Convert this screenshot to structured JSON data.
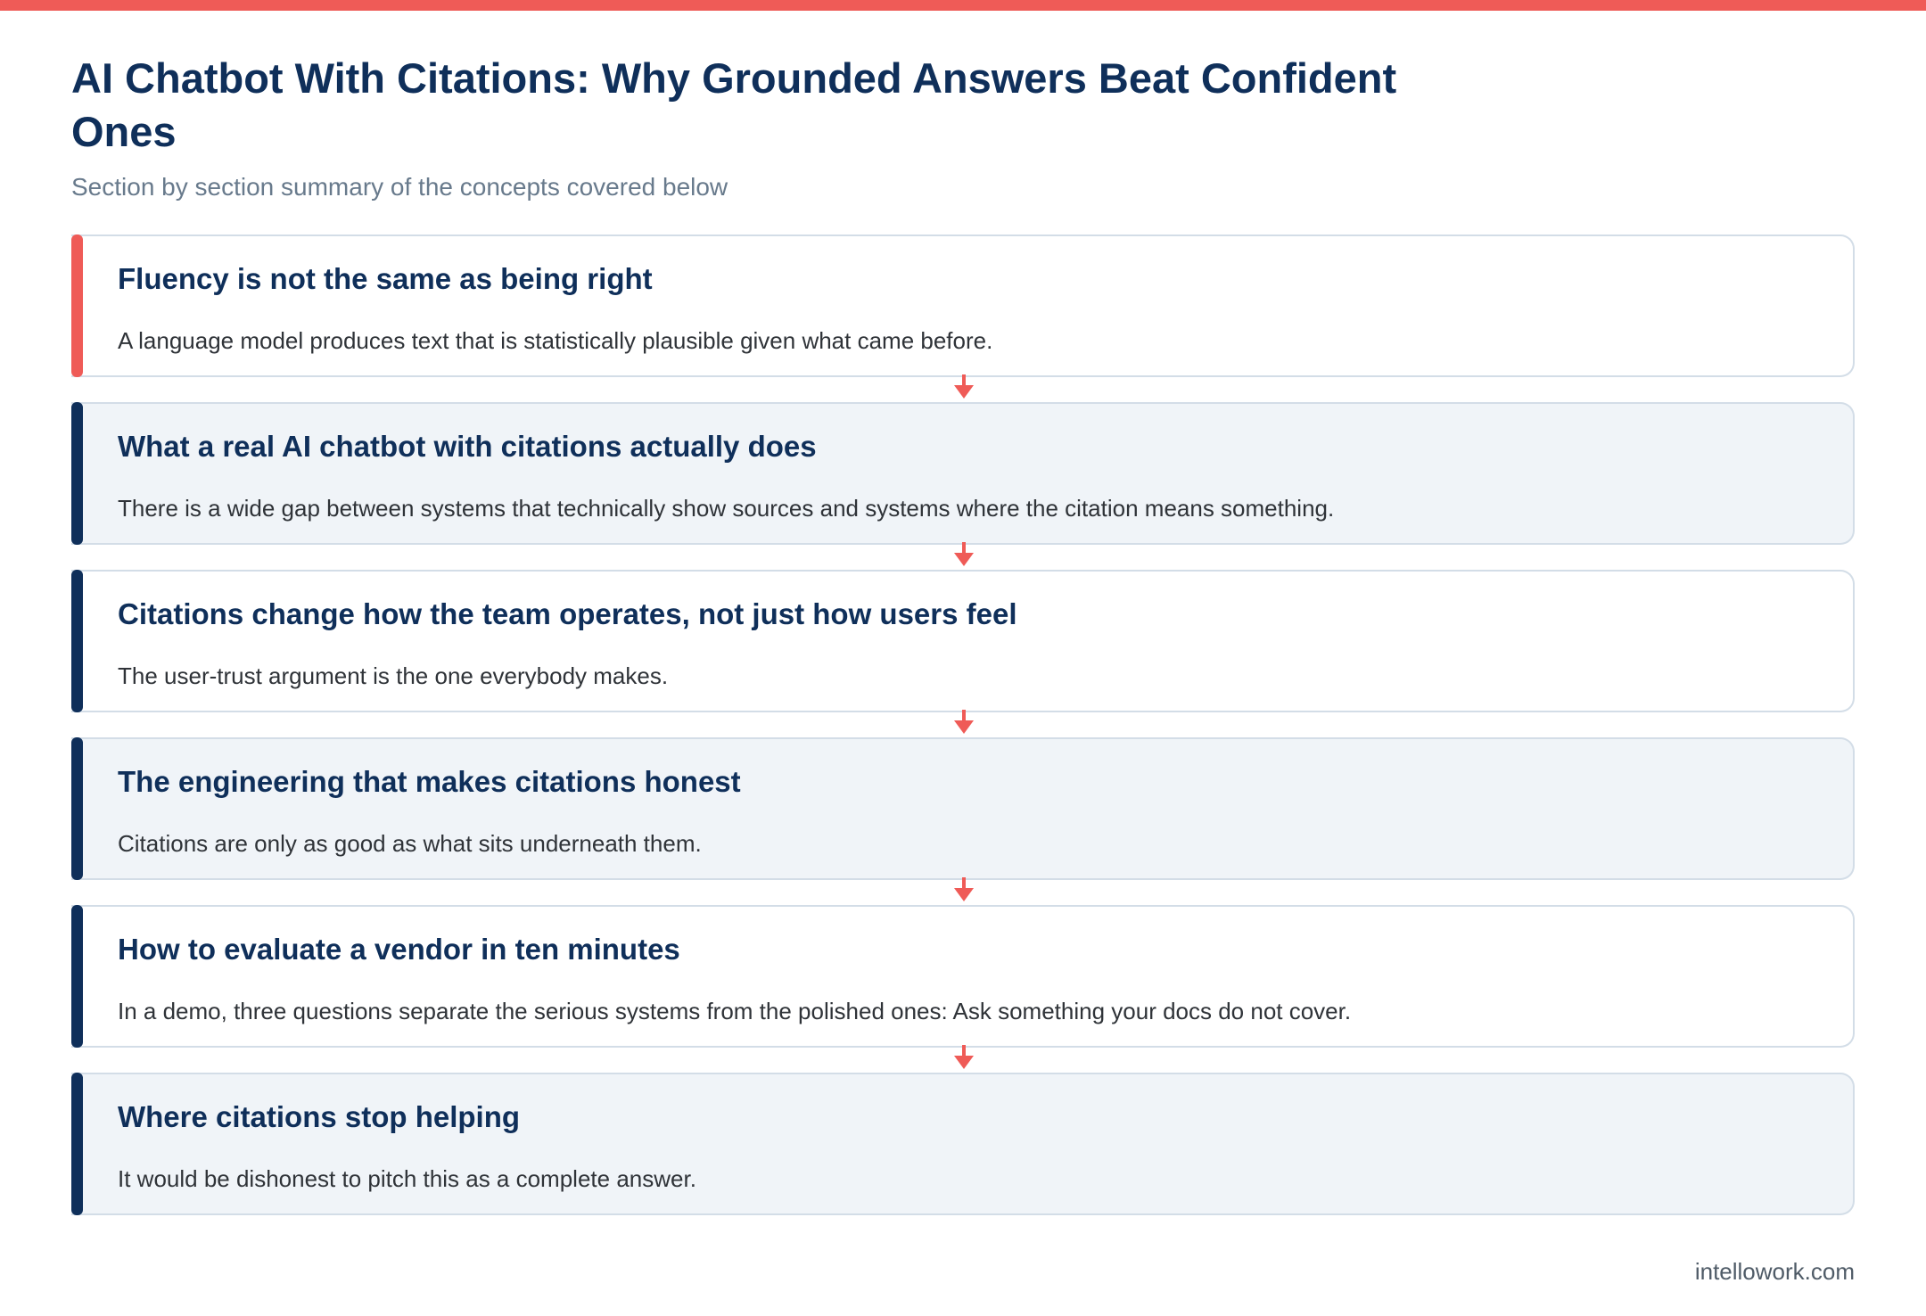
{
  "header": {
    "title": "AI Chatbot With Citations: Why Grounded Answers Beat Confident Ones",
    "subtitle": "Section by section summary of the concepts covered below"
  },
  "sections": [
    {
      "title": "Fluency is not the same as being right",
      "summary": "A language model produces text that is statistically plausible given what came before."
    },
    {
      "title": "What a real AI chatbot with citations actually does",
      "summary": "There is a wide gap between systems that technically show sources and systems where the citation means something."
    },
    {
      "title": "Citations change how the team operates, not just how users feel",
      "summary": "The user-trust argument is the one everybody makes."
    },
    {
      "title": "The engineering that makes citations honest",
      "summary": "Citations are only as good as what sits underneath them."
    },
    {
      "title": "How to evaluate a vendor in ten minutes",
      "summary": "In a demo, three questions separate the serious systems from the polished ones: Ask something your docs do not cover."
    },
    {
      "title": "Where citations stop helping",
      "summary": "It would be dishonest to pitch this as a complete answer."
    }
  ],
  "footer": {
    "site": "intellowork.com"
  },
  "colors": {
    "accent": "#ef5b57",
    "navy": "#0f2f5a",
    "card_alt_bg": "#f0f4f8",
    "border": "#d3dde7"
  }
}
